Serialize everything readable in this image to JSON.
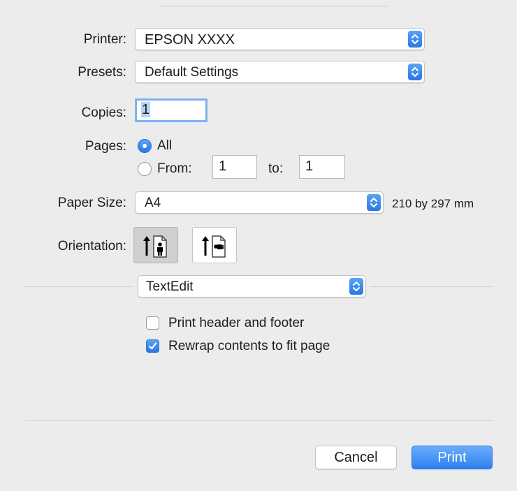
{
  "printer": {
    "label": "Printer:",
    "value": "EPSON XXXX"
  },
  "presets": {
    "label": "Presets:",
    "value": "Default Settings"
  },
  "copies": {
    "label": "Copies:",
    "value": "1"
  },
  "pages": {
    "label": "Pages:",
    "all_label": "All",
    "from_label": "From:",
    "from_value": "1",
    "to_label": "to:",
    "to_value": "1",
    "selected": "All"
  },
  "paper_size": {
    "label": "Paper Size:",
    "value": "A4",
    "dimensions": "210 by 297 mm"
  },
  "orientation": {
    "label": "Orientation:",
    "selected": "portrait",
    "options": [
      "portrait",
      "landscape"
    ]
  },
  "app_section": {
    "value": "TextEdit"
  },
  "options": {
    "print_header_footer": {
      "label": "Print header and footer",
      "checked": false
    },
    "rewrap_contents": {
      "label": "Rewrap contents to fit page",
      "checked": true
    }
  },
  "buttons": {
    "cancel": "Cancel",
    "print": "Print"
  },
  "colors": {
    "accent": "#2a78e4",
    "panel": "#ececec",
    "focus_ring": "#7fb1f0"
  },
  "icons": {
    "popup": "up-down-chevron-icon",
    "orientation_portrait": "portrait-page-icon",
    "orientation_landscape": "landscape-page-icon",
    "check": "checkmark-icon"
  }
}
